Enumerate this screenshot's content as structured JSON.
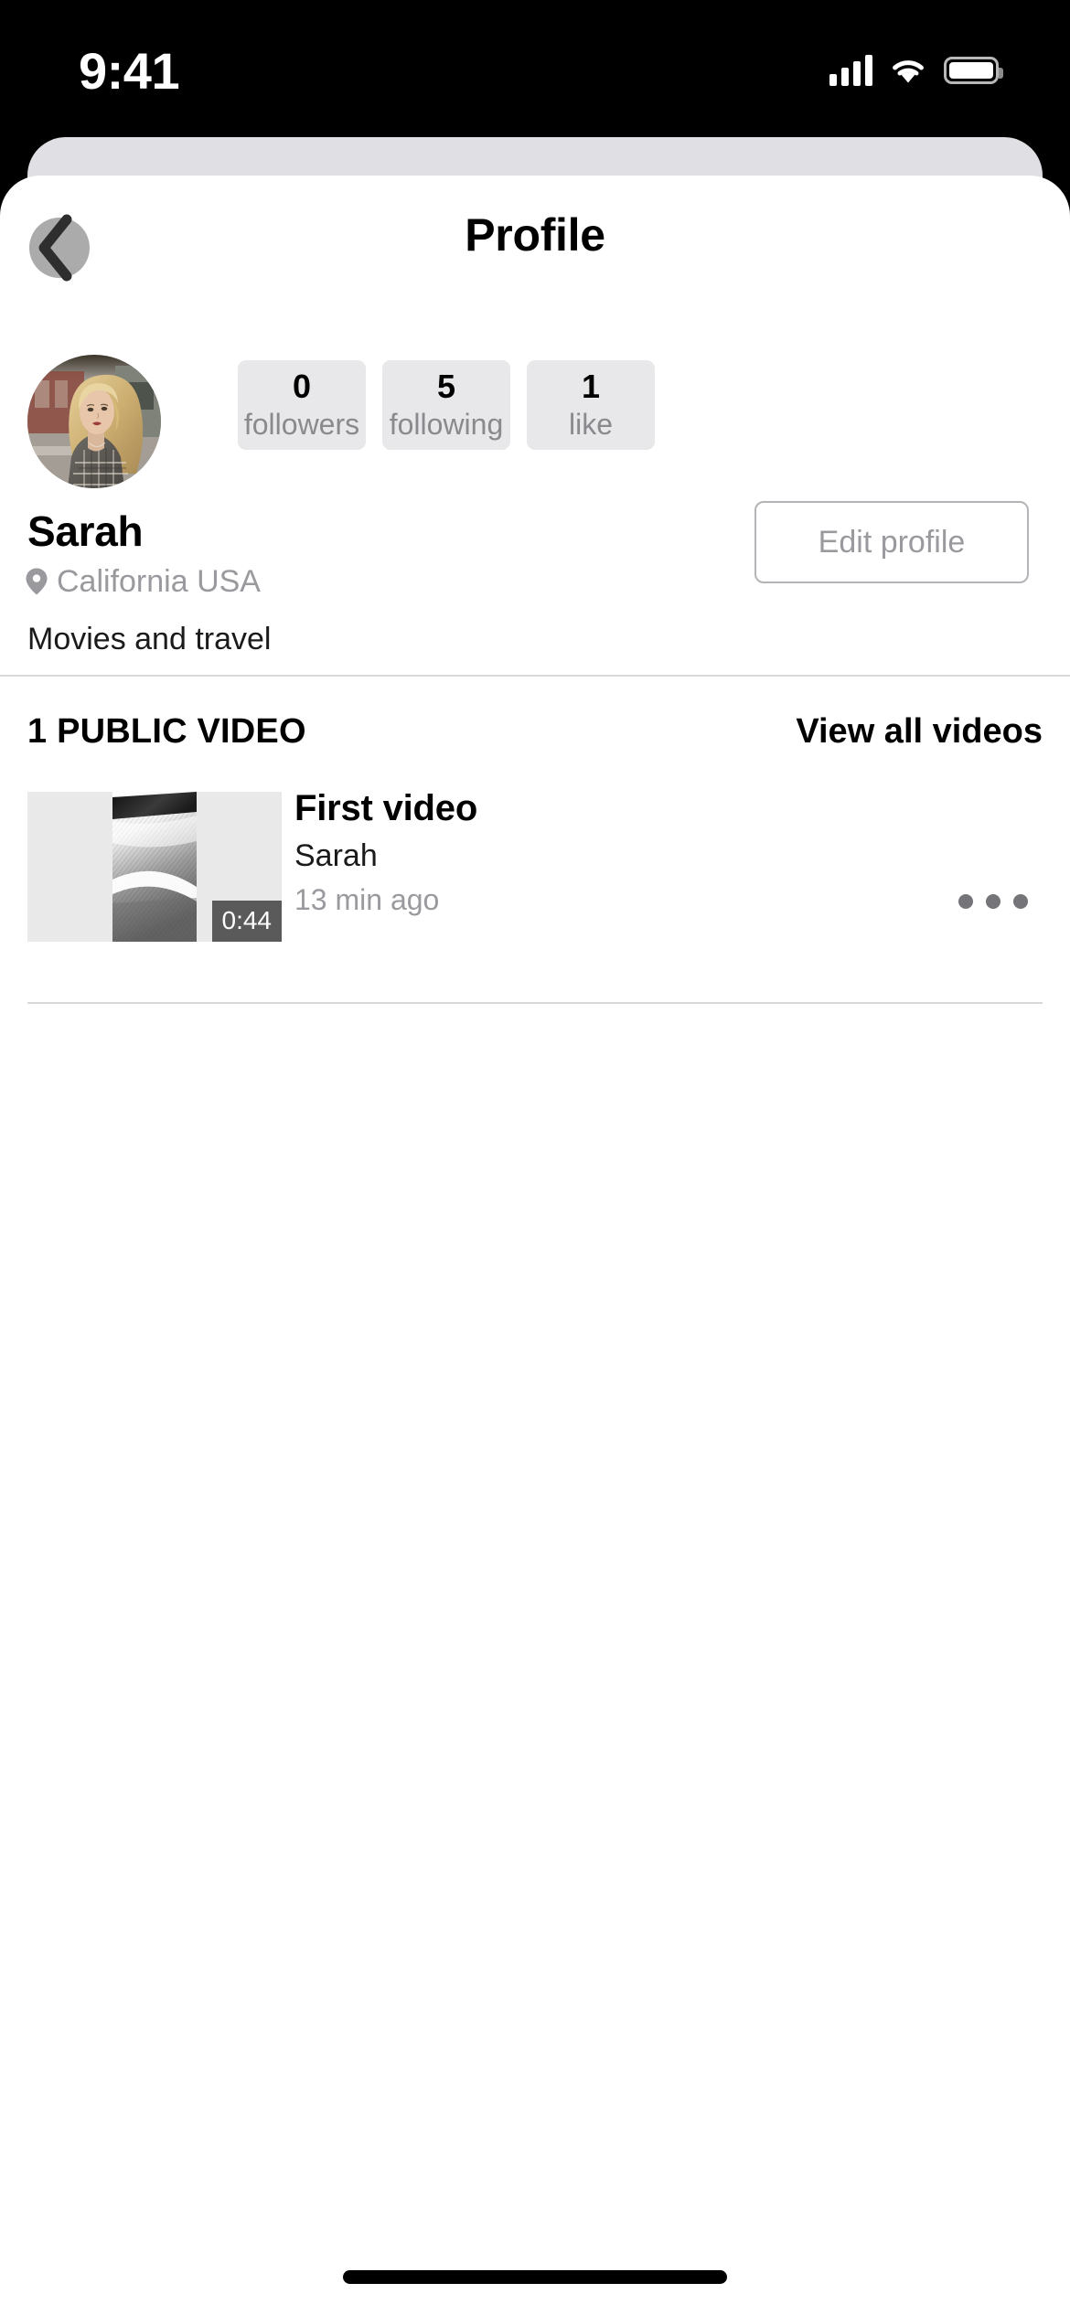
{
  "status_bar": {
    "time": "9:41",
    "cellular_icon": "cellular-signal-icon",
    "wifi_icon": "wifi-icon",
    "battery_icon": "battery-icon"
  },
  "nav": {
    "title": "Profile",
    "back_icon": "back-chevron-icon"
  },
  "profile": {
    "avatar_alt": "Sarah profile photo",
    "name": "Sarah",
    "location": "California USA",
    "location_icon": "map-pin-icon",
    "bio": "Movies and travel",
    "edit_button_label": "Edit profile",
    "stats": [
      {
        "value": "0",
        "label": "followers"
      },
      {
        "value": "5",
        "label": "following"
      },
      {
        "value": "1",
        "label": "like"
      }
    ]
  },
  "videos_section": {
    "heading": "1 PUBLIC VIDEO",
    "view_all_label": "View all videos",
    "items": [
      {
        "title": "First video",
        "author": "Sarah",
        "timestamp": "13 min ago",
        "duration": "0:44",
        "more_icon": "overflow-menu-icon"
      }
    ]
  },
  "colors": {
    "sheet_background": "#FFFFFF",
    "backdrop": "#000000",
    "sheet_behind": "#E0DFE4",
    "stat_chip": "#E8E8EA",
    "muted_text": "#9A9A9E",
    "divider": "#D8D8DA",
    "duration_badge": "#5A5A5A",
    "back_button_circle": "#ABABAB"
  }
}
